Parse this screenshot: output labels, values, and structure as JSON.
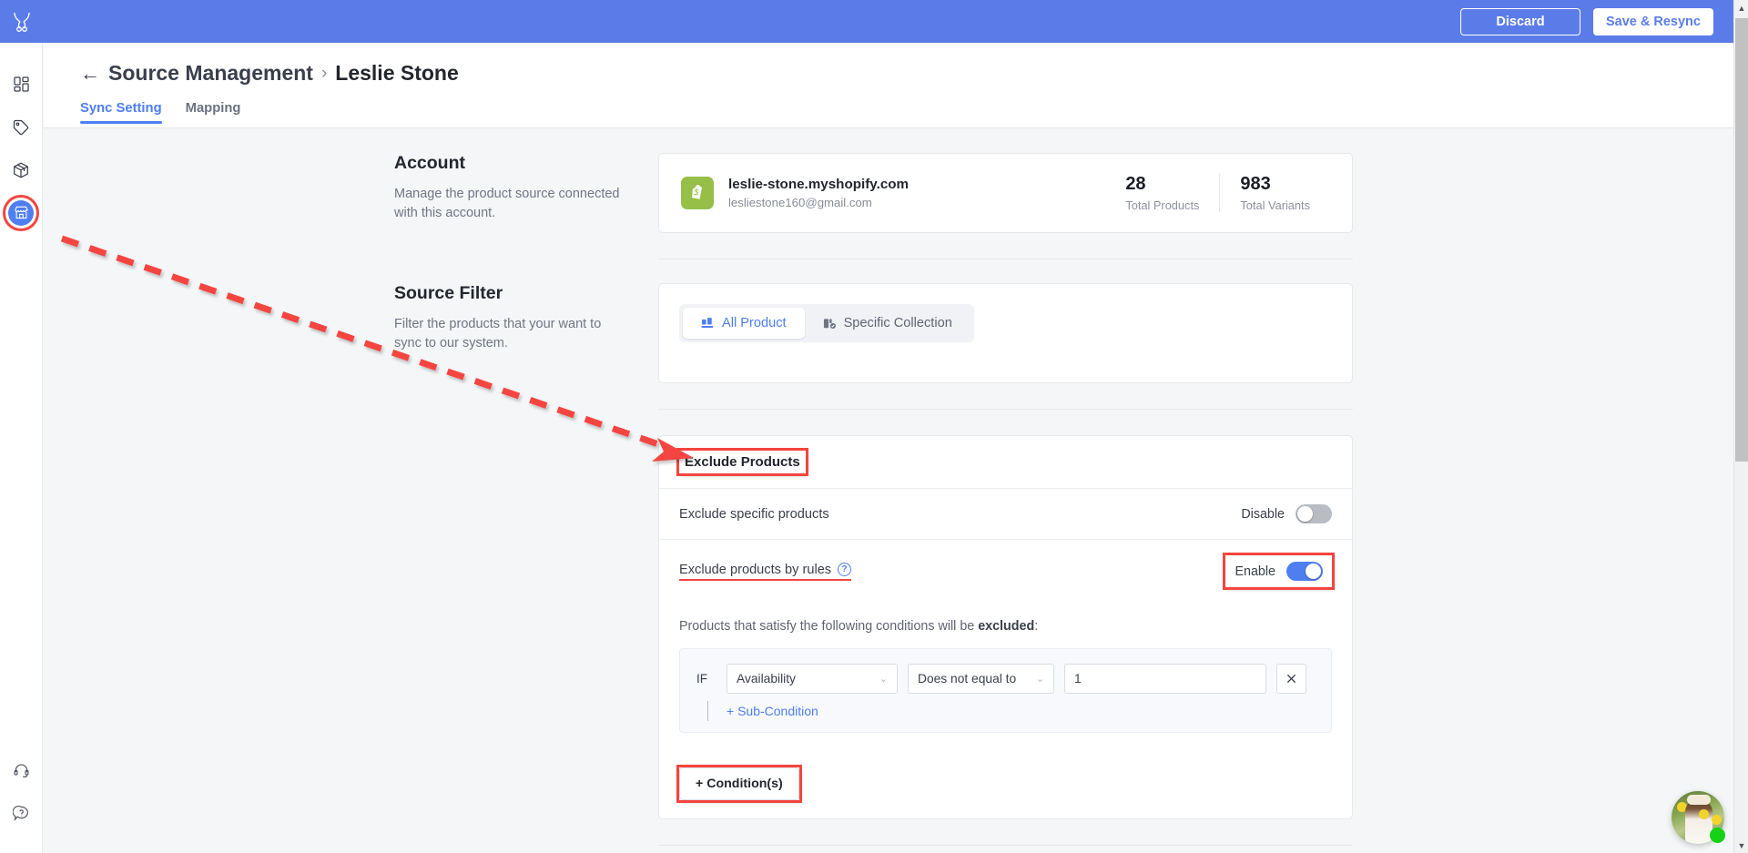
{
  "topbar": {
    "logo_icon": "antlers-logo-icon",
    "discard_label": "Discard",
    "save_label": "Save & Resync",
    "background_color": "#5b7ce8"
  },
  "sidebar": {
    "items": [
      {
        "name": "dashboard",
        "icon": "dashboard-grid-icon",
        "active": false
      },
      {
        "name": "tags",
        "icon": "price-tag-icon",
        "active": false
      },
      {
        "name": "products",
        "icon": "package-box-icon",
        "active": false
      },
      {
        "name": "source-management",
        "icon": "storefront-icon",
        "active": true
      }
    ],
    "bottom_items": [
      {
        "name": "support",
        "icon": "headset-icon"
      },
      {
        "name": "help",
        "icon": "question-bubble-icon"
      }
    ],
    "active_highlight_color": "#f4453f"
  },
  "header": {
    "back_arrow": "←",
    "breadcrumb_root": "Source Management",
    "breadcrumb_separator": "›",
    "breadcrumb_current": "Leslie Stone",
    "tabs": [
      {
        "label": "Sync Setting",
        "active": true
      },
      {
        "label": "Mapping",
        "active": false
      }
    ],
    "accent_color": "#4f7ef0"
  },
  "account": {
    "title": "Account",
    "description": "Manage the product source connected with this account.",
    "shop_icon": "shopify-bag-icon",
    "domain": "leslie-stone.myshopify.com",
    "email": "lesliestone160@gmail.com",
    "stats": [
      {
        "value": "28",
        "label": "Total Products"
      },
      {
        "value": "983",
        "label": "Total Variants"
      }
    ]
  },
  "source_filter": {
    "title": "Source Filter",
    "description": "Filter the products that your want to sync to our system.",
    "options": [
      {
        "label": "All Product",
        "icon": "all-product-icon",
        "active": true
      },
      {
        "label": "Specific Collection",
        "icon": "collection-check-icon",
        "active": false
      }
    ]
  },
  "exclude_products": {
    "heading": "Exclude Products",
    "specific": {
      "label": "Exclude specific products",
      "toggle_label": "Disable",
      "enabled": false
    },
    "by_rules": {
      "label": "Exclude products by rules",
      "help_icon": "question-circle-icon",
      "toggle_label": "Enable",
      "enabled": true
    },
    "rules_note_prefix": "Products that satisfy the following conditions will be ",
    "rules_note_strong": "excluded",
    "rules_note_suffix": ":",
    "condition": {
      "if_label": "IF",
      "field_value": "Availability",
      "field_options": [
        "Availability"
      ],
      "operator_value": "Does not equal to",
      "operator_options": [
        "Does not equal to"
      ],
      "input_value": "1",
      "remove_icon": "close-x-icon",
      "sub_condition_label": "+ Sub-Condition"
    },
    "add_condition_label": "+ Condition(s)"
  },
  "annotation": {
    "arrow_color": "#f4453f",
    "style": "dashed-arrow",
    "from": "sidebar-item-source-management",
    "to": "exclude-products-heading"
  },
  "scrollbar": {
    "up_arrow": "▲",
    "down_arrow": "▼"
  },
  "chat_widget": {
    "name": "support-chat-avatar",
    "status": "online",
    "status_color": "#17d117"
  }
}
